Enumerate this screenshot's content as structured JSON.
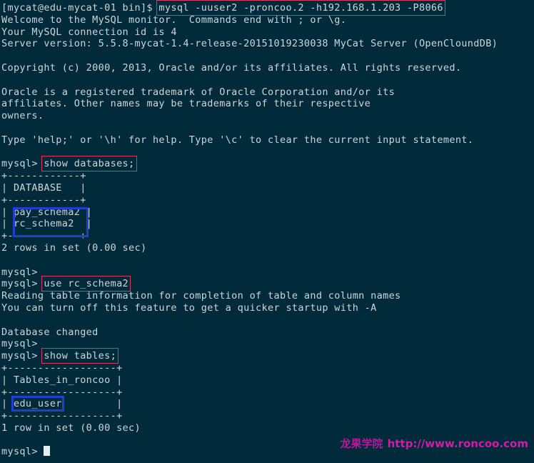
{
  "terminal": {
    "background_color": "#012b3a",
    "text_color": "#ced6d8",
    "highlight_red": "#d93a5e",
    "highlight_blue": "#1f3fcf",
    "prompt": "mysql> ",
    "shell_prompt": "[mycat@edu-mycat-01 bin]$ "
  },
  "session": {
    "connect_command": "mysql -uuser2 -proncoo.2 -h192.168.1.203 -P8066",
    "banner": [
      "Welcome to the MySQL monitor.  Commands end with ; or \\g.",
      "Your MySQL connection id is 4",
      "Server version: 5.5.8-mycat-1.4-release-20151019230038 MyCat Server (OpenCloundDB)"
    ],
    "copyright": "Copyright (c) 2000, 2013, Oracle and/or its affiliates. All rights reserved.",
    "trademark": [
      "Oracle is a registered trademark of Oracle Corporation and/or its",
      "affiliates. Other names may be trademarks of their respective",
      "owners."
    ],
    "help_hint": "Type 'help;' or '\\h' for help. Type '\\c' to clear the current input statement."
  },
  "show_databases": {
    "command": "show databases;",
    "separator": "+------------+",
    "header_row": "| DATABASE   |",
    "rows": [
      "| pay_schema2 |",
      "| rc_schema2  |"
    ],
    "row_values": [
      "pay_schema2",
      "rc_schema2"
    ],
    "result": "2 rows in set (0.00 sec)"
  },
  "use_database": {
    "command": "use rc_schema2",
    "output": [
      "Reading table information for completion of table and column names",
      "You can turn off this feature to get a quicker startup with -A"
    ],
    "status": "Database changed"
  },
  "show_tables": {
    "command": "show tables;",
    "separator": "+------------------+",
    "header_row": "| Tables_in_roncoo |",
    "row_value": "edu_user",
    "result": "1 row in set (0.00 sec)"
  },
  "watermark": {
    "brand": "龙果学院",
    "url": "http://www.roncoo.com"
  }
}
